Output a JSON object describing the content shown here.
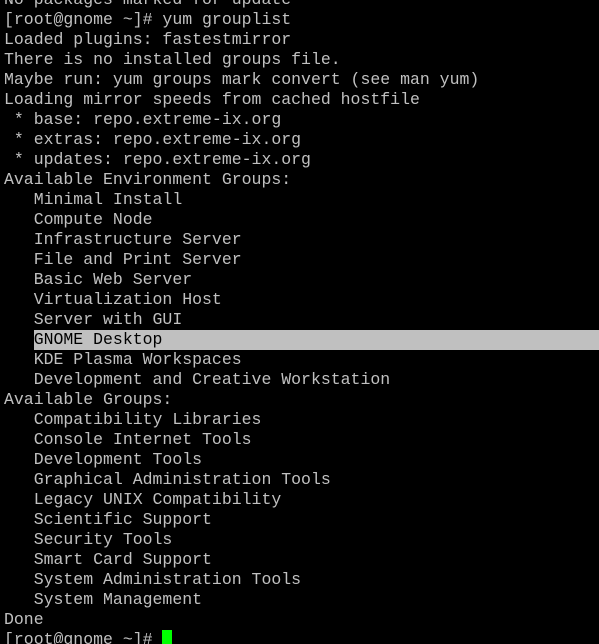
{
  "terminal": {
    "colors": {
      "background": "#000000",
      "foreground": "#c0c0c0",
      "selection_bg": "#c0c0c0",
      "selection_fg": "#000000",
      "cursor": "#00ff00"
    },
    "lines": [
      "No packages marked for update",
      "[root@gnome ~]# yum grouplist",
      "Loaded plugins: fastestmirror",
      "There is no installed groups file.",
      "Maybe run: yum groups mark convert (see man yum)",
      "Loading mirror speeds from cached hostfile",
      " * base: repo.extreme-ix.org",
      " * extras: repo.extreme-ix.org",
      " * updates: repo.extreme-ix.org",
      "Available Environment Groups:",
      "   Minimal Install",
      "   Compute Node",
      "   Infrastructure Server",
      "   File and Print Server",
      "   Basic Web Server",
      "   Virtualization Host",
      "   Server with GUI",
      "   GNOME Desktop",
      "   KDE Plasma Workspaces",
      "   Development and Creative Workstation",
      "Available Groups:",
      "   Compatibility Libraries",
      "   Console Internet Tools",
      "   Development Tools",
      "   Graphical Administration Tools",
      "   Legacy UNIX Compatibility",
      "   Scientific Support",
      "   Security Tools",
      "   Smart Card Support",
      "   System Administration Tools",
      "   System Management",
      "Done"
    ],
    "highlighted_line_index": 17,
    "prompt": "[root@gnome ~]# "
  }
}
